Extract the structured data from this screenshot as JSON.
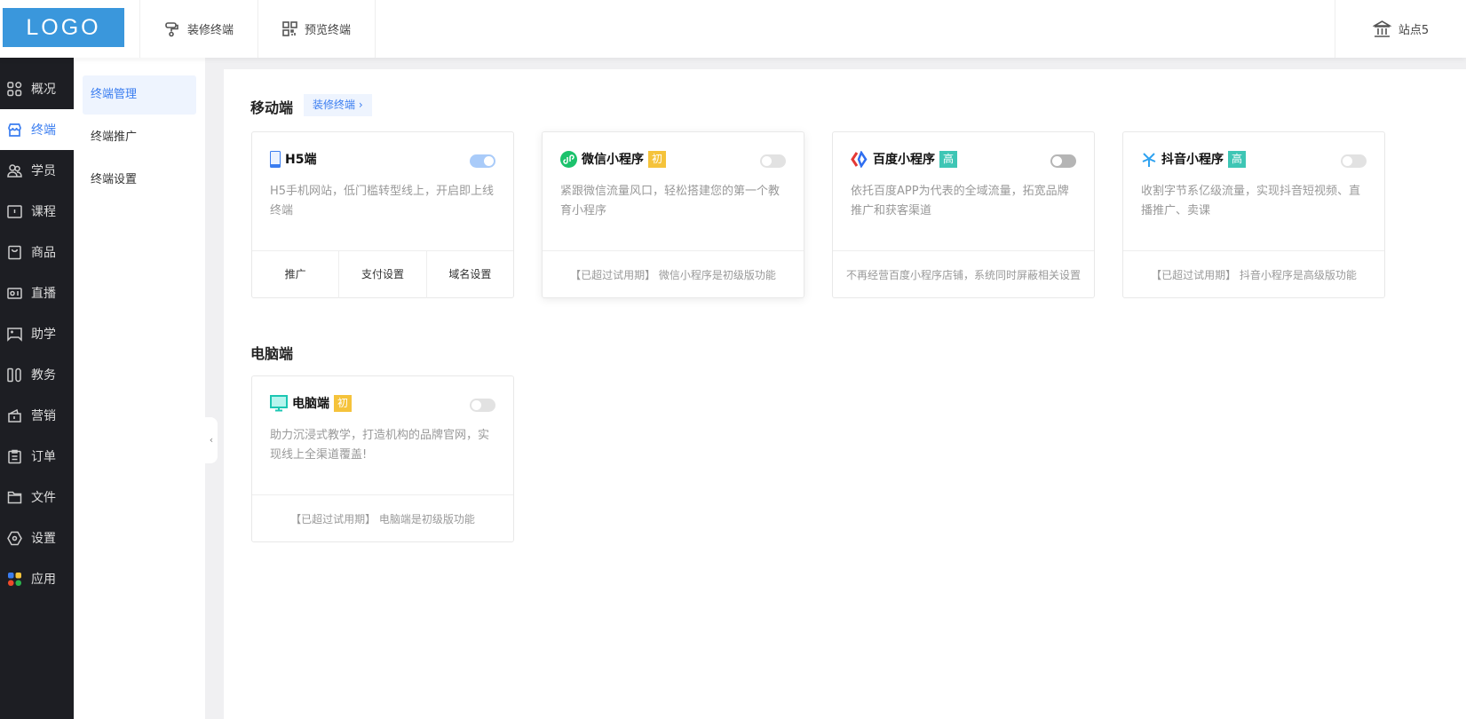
{
  "header": {
    "logo": "LOGO",
    "nav": [
      {
        "label": "装修终端",
        "icon": "paint-roller-icon"
      },
      {
        "label": "预览终端",
        "icon": "qrcode-icon"
      }
    ],
    "site": {
      "label": "站点5",
      "icon": "bank-icon"
    }
  },
  "sidebar": {
    "items": [
      {
        "label": "概况"
      },
      {
        "label": "终端",
        "active": true
      },
      {
        "label": "学员"
      },
      {
        "label": "课程"
      },
      {
        "label": "商品"
      },
      {
        "label": "直播"
      },
      {
        "label": "助学"
      },
      {
        "label": "教务"
      },
      {
        "label": "营销"
      },
      {
        "label": "订单"
      },
      {
        "label": "文件"
      },
      {
        "label": "设置"
      },
      {
        "label": "应用"
      }
    ]
  },
  "subnav": {
    "items": [
      {
        "label": "终端管理",
        "active": true
      },
      {
        "label": "终端推广"
      },
      {
        "label": "终端设置"
      }
    ]
  },
  "mobile": {
    "title": "移动端",
    "decorate": "装修终端",
    "cards": [
      {
        "name": "H5端",
        "desc": "H5手机网站，低门槛转型线上，开启即上线终端",
        "toggle": true,
        "actions": [
          "推广",
          "支付设置",
          "域名设置"
        ]
      },
      {
        "name": "微信小程序",
        "badge": "初",
        "desc": "紧跟微信流量风口，轻松搭建您的第一个教育小程序",
        "toggle": false,
        "footer": "【已超过试用期】 微信小程序是初级版功能"
      },
      {
        "name": "百度小程序",
        "badge": "高",
        "desc": "依托百度APP为代表的全域流量，拓宽品牌推广和获客渠道",
        "toggle": false,
        "footer": "不再经营百度小程序店铺，系统同时屏蔽相关设置"
      },
      {
        "name": "抖音小程序",
        "badge": "高",
        "desc": "收割字节系亿级流量，实现抖音短视频、直播推广、卖课",
        "toggle": false,
        "footer": "【已超过试用期】 抖音小程序是高级版功能"
      }
    ]
  },
  "pc": {
    "title": "电脑端",
    "cards": [
      {
        "name": "电脑端",
        "badge": "初",
        "desc": "助力沉浸式教学，打造机构的品牌官网，实现线上全渠道覆盖!",
        "toggle": false,
        "footer": "【已超过试用期】 电脑端是初级版功能"
      }
    ]
  },
  "colors": {
    "accent": "#3a7df0",
    "sidebar": "#1d1e23",
    "logo": "#3a97dc",
    "badge_init": "#f5c33b",
    "badge_adv": "#3ec6b5"
  }
}
